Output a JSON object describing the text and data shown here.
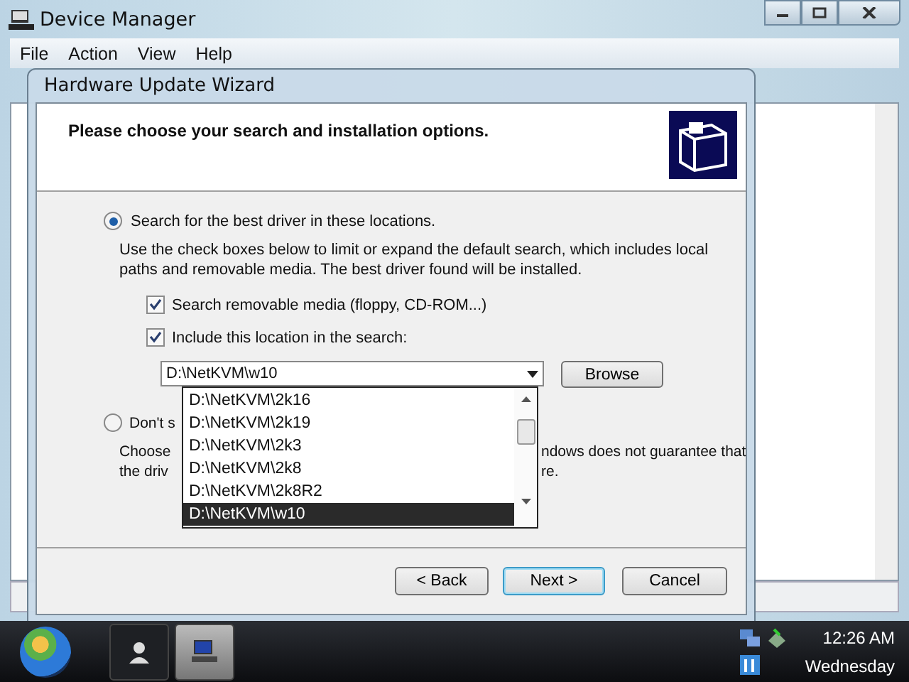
{
  "window": {
    "title": "Device Manager"
  },
  "menu": [
    "File",
    "Action",
    "View",
    "Help"
  ],
  "wizard": {
    "title": "Hardware Update Wizard",
    "heading": "Please choose your search and installation options.",
    "search_choice": {
      "label": "Search for the best driver in these locations.",
      "selected": true,
      "description": "Use the check boxes below to limit or expand the default search, which includes local paths and removable media. The best driver found will be installed."
    },
    "checkboxes": [
      {
        "label": "Search removable media (floppy, CD-ROM...)",
        "checked": true
      },
      {
        "label": "Include this location in the search:",
        "checked": true
      }
    ],
    "location": {
      "value": "D:\\NetKVM\\w10",
      "browse": "Browse",
      "dropdown": [
        {
          "label": "D:\\NetKVM\\2k16",
          "selected": false
        },
        {
          "label": "D:\\NetKVM\\2k19",
          "selected": false
        },
        {
          "label": "D:\\NetKVM\\2k3",
          "selected": false
        },
        {
          "label": "D:\\NetKVM\\2k8",
          "selected": false
        },
        {
          "label": "D:\\NetKVM\\2k8R2",
          "selected": false
        },
        {
          "label": "D:\\NetKVM\\w10",
          "selected": true
        }
      ]
    },
    "manual_choice": {
      "label": "Don't s",
      "selected": false,
      "description_lines": [
        {
          "left": "Choose",
          "right": "ndows does not guarantee that"
        },
        {
          "left": "the driv",
          "right": "re."
        }
      ]
    },
    "buttons": [
      {
        "label": "< Back",
        "default": false
      },
      {
        "label": "Next >",
        "default": true
      },
      {
        "label": "Cancel",
        "default": false
      }
    ]
  },
  "taskbar": {
    "time": "12:26 AM",
    "day": "Wednesday"
  }
}
